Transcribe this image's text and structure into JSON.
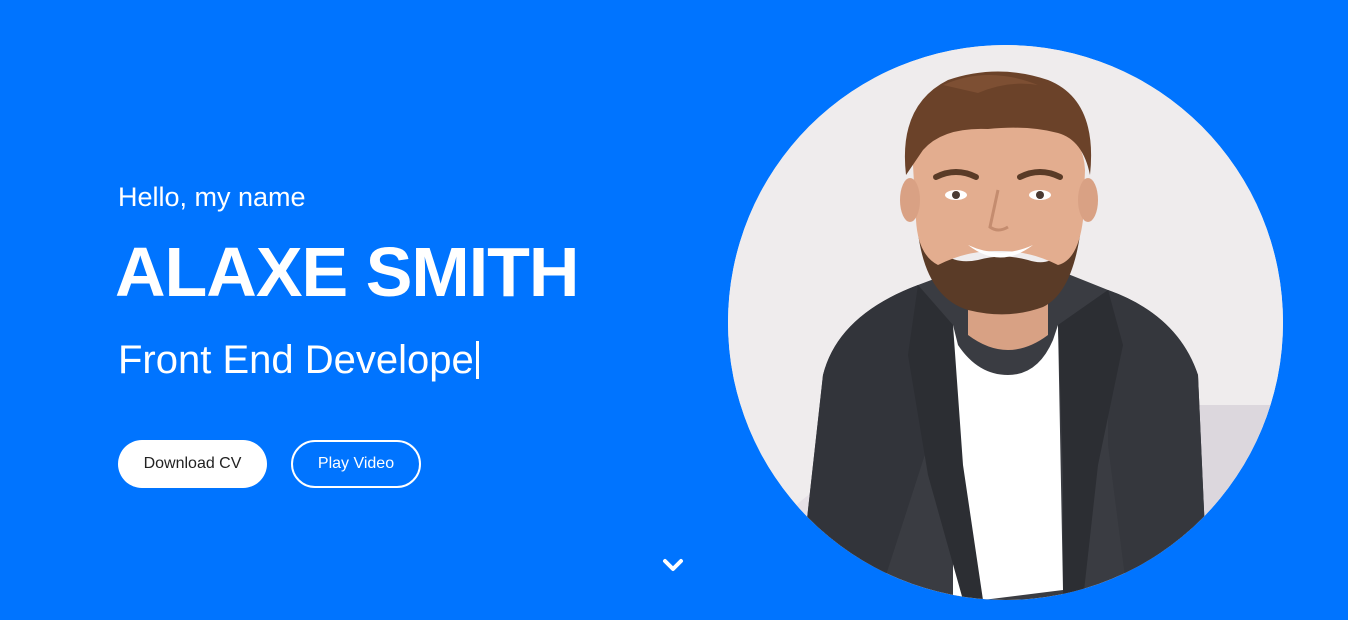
{
  "hero": {
    "greeting": "Hello, my name",
    "name": "ALAXE SMITH",
    "role": "Front End Develope"
  },
  "buttons": {
    "download": "Download CV",
    "video": "Play Video"
  },
  "icons": {
    "scroll": "chevron-down-icon"
  },
  "colors": {
    "background": "#0074ff",
    "text": "#ffffff",
    "button_text": "#222222"
  }
}
